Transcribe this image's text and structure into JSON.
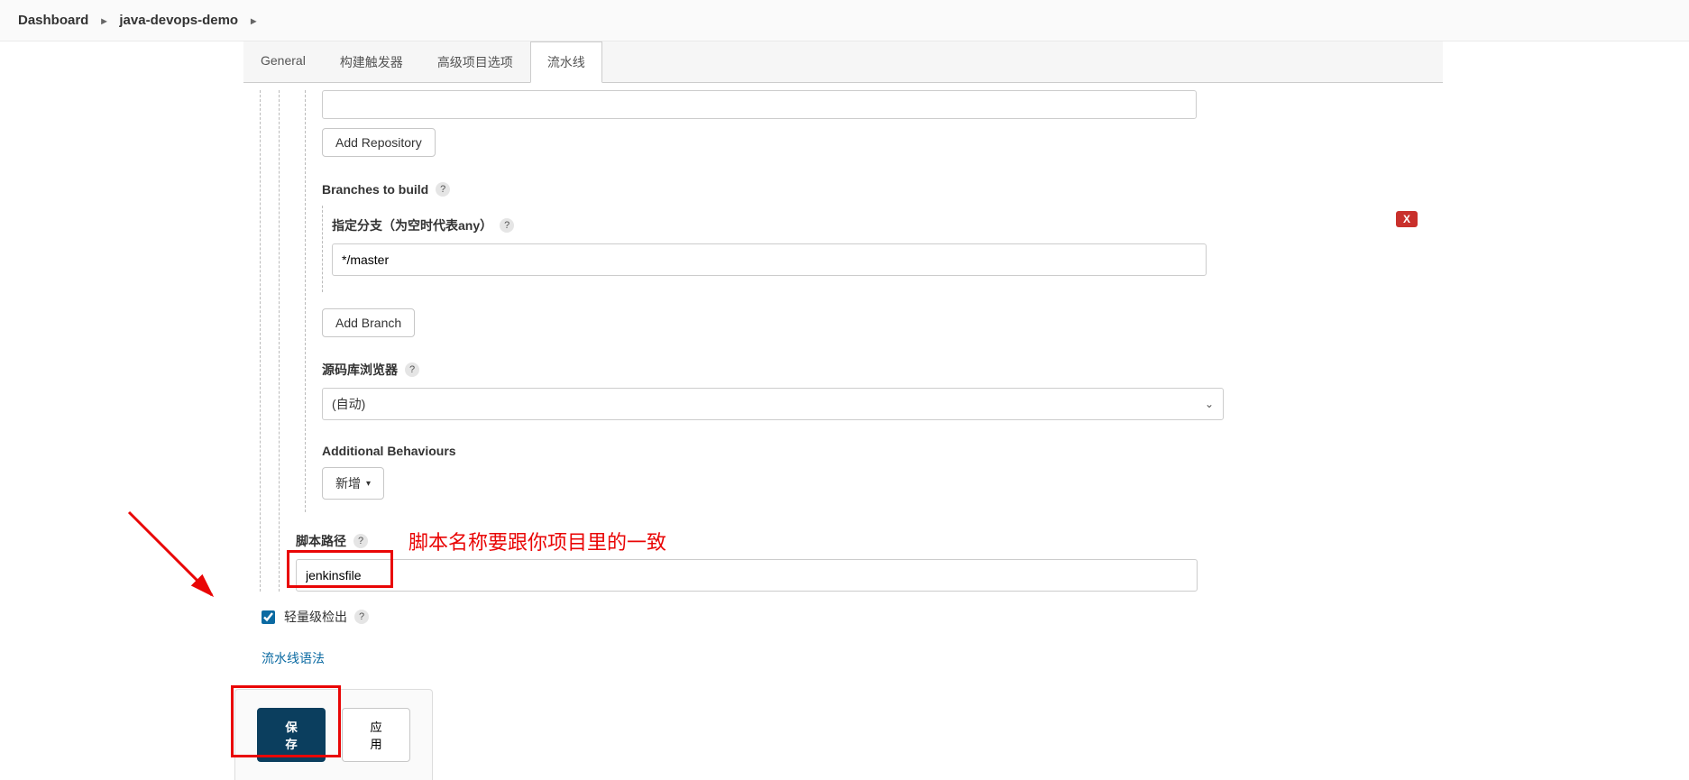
{
  "breadcrumb": {
    "items": [
      "Dashboard",
      "java-devops-demo"
    ]
  },
  "tabs": {
    "items": [
      "General",
      "构建触发器",
      "高级项目选项",
      "流水线"
    ],
    "active": "流水线"
  },
  "buttons": {
    "add_repository": "Add Repository",
    "add_branch": "Add Branch",
    "add_new": "新增",
    "save": "保存",
    "apply": "应用"
  },
  "sections": {
    "branches_to_build": "Branches to build",
    "branch_specifier": "指定分支（为空时代表any）",
    "repo_browser": "源码库浏览器",
    "additional_behaviours": "Additional Behaviours",
    "script_path": "脚本路径",
    "lightweight_checkout": "轻量级检出"
  },
  "values": {
    "branch": "*/master",
    "repo_browser_selected": "(自动)",
    "script_path": "jenkinsfile",
    "lightweight_checked": true
  },
  "link": {
    "pipeline_syntax": "流水线语法"
  },
  "delete_badge": "X",
  "help_char": "?",
  "annotation": {
    "text": "脚本名称要跟你项目里的一致"
  }
}
